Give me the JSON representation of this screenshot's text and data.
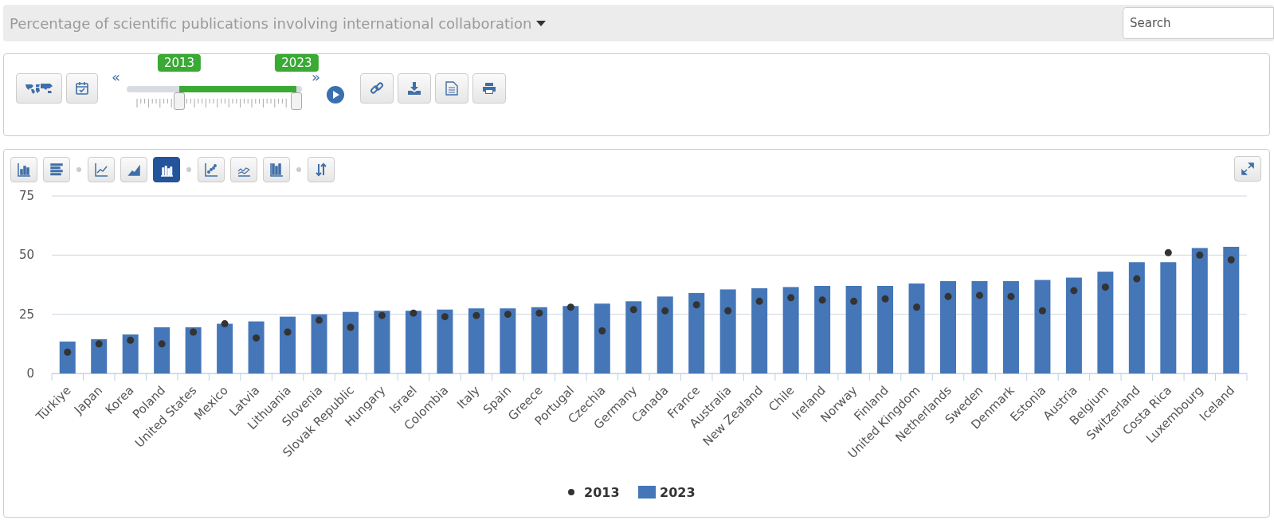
{
  "header": {
    "title": "Percentage of scientific publications involving international collaboration",
    "search": {
      "placeholder": "Search"
    }
  },
  "controls": {
    "left_buttons": [
      {
        "kind": "map"
      },
      {
        "kind": "calendar"
      }
    ],
    "slider": {
      "prev": "«",
      "next": "»",
      "handles": [
        {
          "label": "2013",
          "level": 0.3
        },
        {
          "label": "2023",
          "level": 0.97
        }
      ]
    },
    "right_buttons": [
      {
        "kind": "link"
      },
      {
        "kind": "download"
      },
      {
        "kind": "document"
      },
      {
        "kind": "print"
      }
    ]
  },
  "chart_types": [
    [
      {
        "kind": "bar",
        "selected": false
      },
      {
        "kind": "hbar",
        "selected": false
      }
    ],
    [
      {
        "kind": "line",
        "selected": false
      },
      {
        "kind": "area",
        "selected": false
      },
      {
        "kind": "bardot",
        "selected": true
      }
    ],
    [
      {
        "kind": "scatter",
        "selected": false
      },
      {
        "kind": "lines",
        "selected": false
      },
      {
        "kind": "stack",
        "selected": false
      }
    ],
    [
      {
        "kind": "sort",
        "selected": false
      }
    ]
  ],
  "chart_data": {
    "type": "bar",
    "legend": "bottom",
    "ylim": [
      0,
      75
    ],
    "yticks": [
      0,
      25,
      50,
      75
    ],
    "categories": [
      "Türkiye",
      "Japan",
      "Korea",
      "Poland",
      "United States",
      "Mexico",
      "Latvia",
      "Lithuania",
      "Slovenia",
      "Slovak Republic",
      "Hungary",
      "Israel",
      "Colombia",
      "Italy",
      "Spain",
      "Greece",
      "Portugal",
      "Czechia",
      "Germany",
      "Canada",
      "France",
      "Australia",
      "New Zealand",
      "Chile",
      "Ireland",
      "Norway",
      "Finland",
      "United Kingdom",
      "Netherlands",
      "Sweden",
      "Denmark",
      "Estonia",
      "Austria",
      "Belgium",
      "Switzerland",
      "Costa Rica",
      "Luxembourg",
      "Iceland"
    ],
    "series": [
      {
        "name": "2013",
        "type": "scatter",
        "color": "#333333",
        "values": [
          9,
          12.5,
          14,
          12.5,
          17.5,
          21,
          15,
          17.5,
          22.5,
          19.5,
          24.5,
          25.5,
          24,
          24.5,
          25,
          25.5,
          28,
          18,
          27,
          26.5,
          29,
          26.5,
          30.5,
          32,
          31,
          30.5,
          31.5,
          28,
          32.5,
          33,
          32.5,
          26.5,
          35,
          36.5,
          40,
          51,
          50,
          48
        ]
      },
      {
        "name": "2023",
        "color": "#4576b8",
        "values": [
          13.5,
          14.5,
          16.5,
          19.5,
          19.5,
          21,
          22,
          24,
          25,
          26,
          26.5,
          26.5,
          27,
          27.5,
          27.5,
          28,
          28.5,
          29.5,
          30.5,
          32.5,
          34,
          35.5,
          36,
          36.5,
          37,
          37,
          37,
          38,
          39,
          39,
          39,
          39.5,
          40.5,
          43,
          47,
          47,
          53,
          53.5
        ]
      }
    ]
  }
}
